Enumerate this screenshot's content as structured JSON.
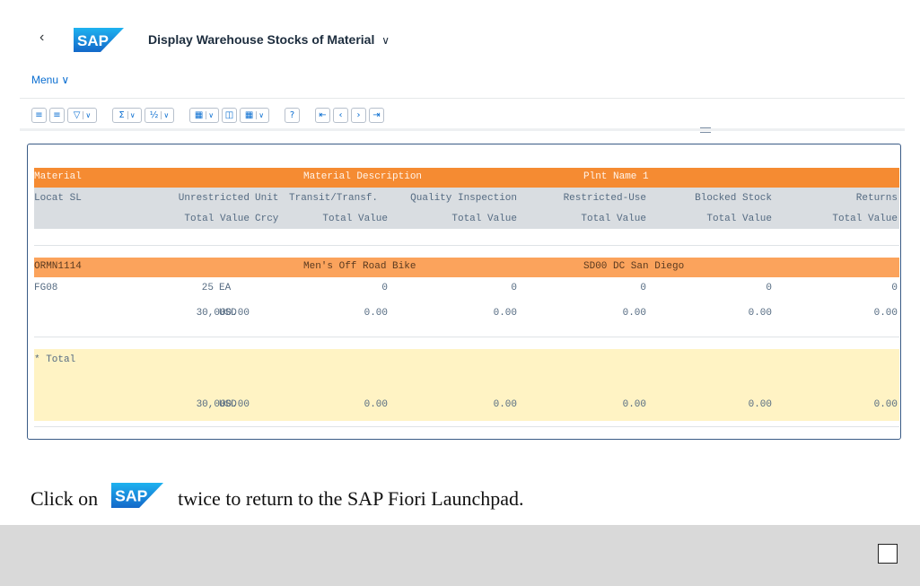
{
  "header": {
    "back_icon": "chevron-left-icon",
    "logo_text": "SAP",
    "title": "Display Warehouse Stocks of Material",
    "title_chevron": "∨"
  },
  "menu": {
    "label": "Menu ∨"
  },
  "toolbar": {
    "buttons": [
      "align-icon",
      "summary-icon",
      "filter-icon",
      "sum-icon",
      "subtotal-icon",
      "export-icon",
      "layout-icon",
      "view-icon",
      "help-icon",
      "first-icon",
      "prev-icon",
      "next-icon",
      "last-icon"
    ]
  },
  "report": {
    "header_row1": {
      "material": "Material",
      "description": "Material Description",
      "plant": "Plnt Name 1"
    },
    "header_row2": {
      "locat": "Locat SL",
      "unrestricted": "Unrestricted",
      "unit": "Unit",
      "transit": "Transit/Transf.",
      "quality": "Quality Inspection",
      "restricted": "Restricted-Use",
      "blocked": "Blocked Stock",
      "returns": "Returns"
    },
    "header_row3": {
      "tv1": "Total Value",
      "crcy": "Crcy",
      "tv2": "Total Value",
      "tv3": "Total Value",
      "tv4": "Total Value",
      "tv5": "Total Value",
      "tv6": "Total Value"
    },
    "material_row": {
      "material": "ORMN1114",
      "description": "Men's Off Road Bike",
      "plant": "SD00 DC San Diego"
    },
    "qty_row": {
      "locat": "FG08",
      "unrestricted": "25",
      "unit": "EA",
      "transit": "0",
      "quality": "0",
      "restricted": "0",
      "blocked": "0",
      "returns": "0"
    },
    "value_row": {
      "total": "30,000.00",
      "crcy": "USD",
      "transit": "0.00",
      "quality": "0.00",
      "restricted": "0.00",
      "blocked": "0.00",
      "returns": "0.00"
    },
    "total_label": "* Total",
    "total_row": {
      "total": "30,000.00",
      "crcy": "USD",
      "transit": "0.00",
      "quality": "0.00",
      "restricted": "0.00",
      "blocked": "0.00",
      "returns": "0.00"
    }
  },
  "instruction": {
    "prefix": "Click on",
    "logo_text": "SAP",
    "suffix": "twice to return to the SAP Fiori Launchpad."
  },
  "colors": {
    "accent": "#0a6ed1",
    "header_orange": "#f58b32",
    "data_orange": "#fba35c",
    "total_yellow": "#fff3c4",
    "sap_blue": "#1a8ad4"
  }
}
